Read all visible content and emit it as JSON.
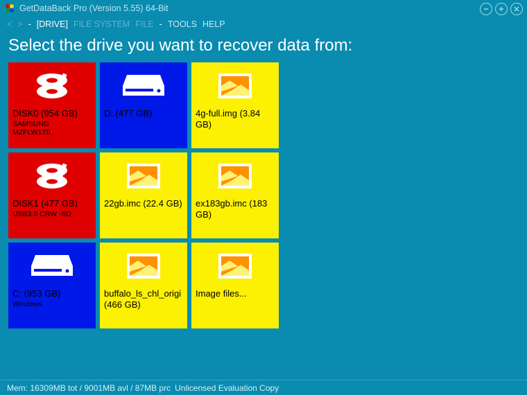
{
  "window": {
    "title": "GetDataBack Pro (Version 5.55) 64-Bit"
  },
  "menu": {
    "back": "<",
    "fwd": ">",
    "sep": "-",
    "drive": "[DRIVE]",
    "filesystem": "FILE SYSTEM",
    "file": "FILE",
    "tools": "TOOLS",
    "help": "HELP"
  },
  "heading": "Select the drive you want to recover data from:",
  "tiles": [
    {
      "kind": "disk",
      "color": "red",
      "l1": "DISK0 (954 GB)",
      "l2": "SAMSUNG MZFLW1T0.."
    },
    {
      "kind": "drive",
      "color": "blue",
      "l1": "D: (477 GB)",
      "l2": ""
    },
    {
      "kind": "image",
      "color": "yellow",
      "l1": "4g-full.img (3.84 GB)",
      "l2": ""
    },
    {
      "kind": "disk",
      "color": "red",
      "l1": "DISK1 (477 GB)",
      "l2": "USB3.0 CRW   -SD"
    },
    {
      "kind": "image",
      "color": "yellow",
      "l1": "22gb.imc (22.4 GB)",
      "l2": ""
    },
    {
      "kind": "image",
      "color": "yellow",
      "l1": "ex183gb.imc (183 GB)",
      "l2": ""
    },
    {
      "kind": "drive",
      "color": "blue",
      "l1": "C: (953 GB)",
      "l2": "Windows"
    },
    {
      "kind": "image",
      "color": "yellow",
      "l1": "buffalo_ls_chl_origi (466 GB)",
      "l2": ""
    },
    {
      "kind": "image",
      "color": "yellow",
      "l1": "Image files...",
      "l2": ""
    }
  ],
  "status": {
    "mem": "Mem: 16309MB tot / 9001MB avl / 87MB prc",
    "license": "Unlicensed Evaluation Copy"
  }
}
